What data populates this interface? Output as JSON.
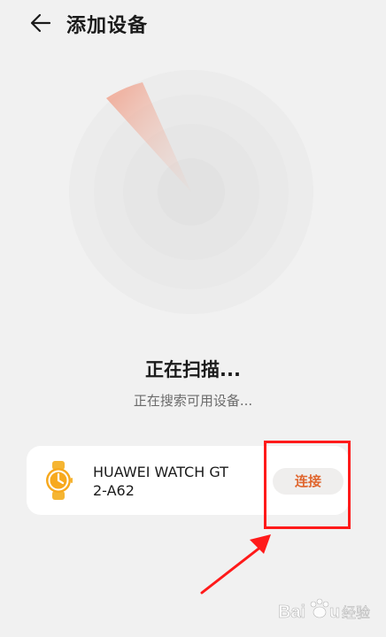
{
  "header": {
    "title": "添加设备",
    "back_icon": "arrow-left-icon"
  },
  "scan": {
    "title": "正在扫描...",
    "subtitle": "正在搜索可用设备...",
    "colors": {
      "sweep": "#f08c6e",
      "ring": "#e6e6e6"
    }
  },
  "device": {
    "icon": "smartwatch-icon",
    "name_line1": "HUAWEI WATCH GT",
    "name_line2": "2-A62",
    "connect_label": "连接",
    "accent": "#e0662e"
  },
  "annotation": {
    "highlight_color": "#ff1a1a"
  },
  "watermark": {
    "text": "Baidu经验"
  }
}
